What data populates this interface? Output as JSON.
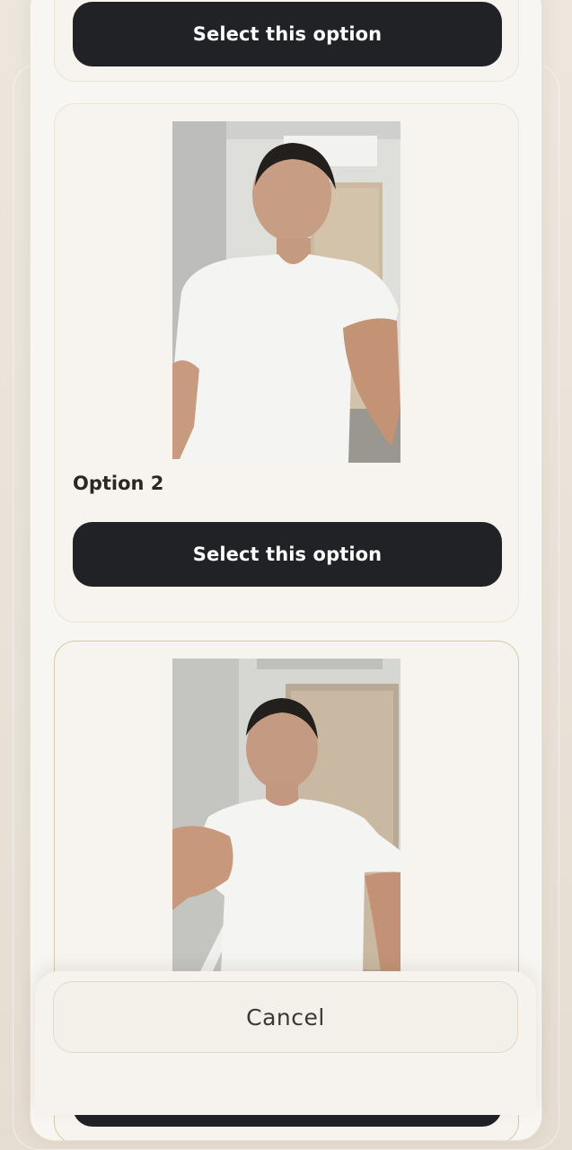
{
  "options": [
    {
      "button_label": "Select this option"
    },
    {
      "label": "Option 2",
      "button_label": "Select this option"
    },
    {
      "button_label": "Select this option"
    }
  ],
  "cancel_label": "Cancel",
  "colors": {
    "button_dark": "#202226",
    "sheet_bg": "#f8f6f2",
    "card_border": "#ece3d2",
    "selected_border": "#d9c9a3"
  }
}
